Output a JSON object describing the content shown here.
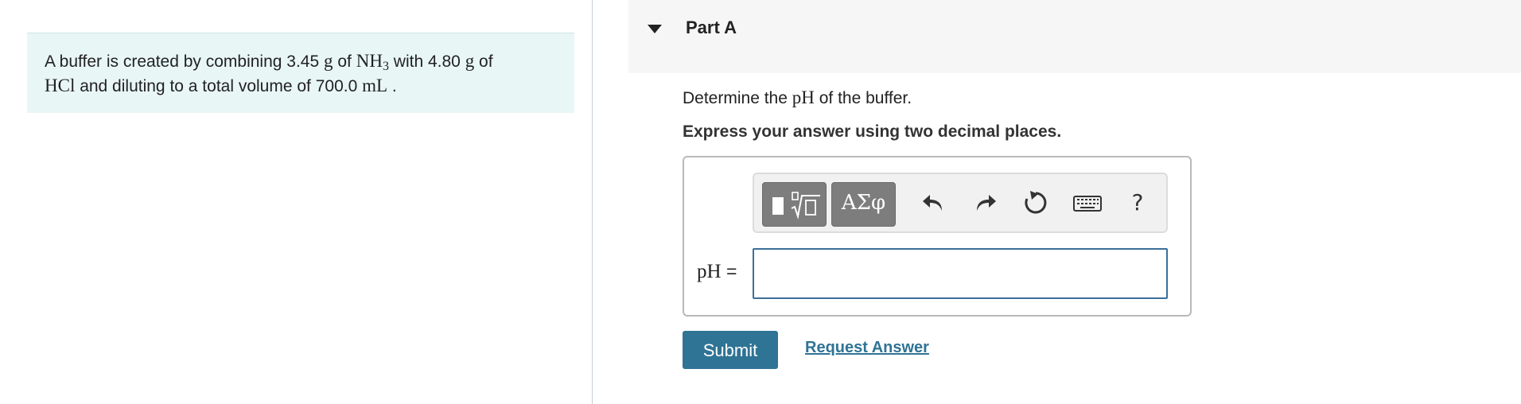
{
  "problem": {
    "text_1": "A buffer is created by combining 3.45",
    "unit_g_1": "g",
    "text_2": "of",
    "nh3_base": "NH",
    "nh3_sub": "3",
    "text_3": "with 4.80",
    "unit_g_2": "g",
    "text_4": "of",
    "hcl": "HCl",
    "text_5": "and diluting to a total volume of 700.0",
    "unit_ml": "mL",
    "text_6": "."
  },
  "part": {
    "title": "Part A",
    "question_prefix": "Determine the",
    "question_ph": "pH",
    "question_suffix": "of the buffer.",
    "instruction": "Express your answer using two decimal places."
  },
  "toolbar": {
    "symbols_label": "ΑΣφ",
    "help_label": "?",
    "icons": [
      "templates-icon",
      "symbols-icon",
      "undo-icon",
      "redo-icon",
      "reset-icon",
      "keyboard-icon",
      "help-icon"
    ]
  },
  "answer": {
    "label_var": "pH",
    "label_eq": " =",
    "value": ""
  },
  "actions": {
    "submit_label": "Submit",
    "request_label": "Request Answer"
  },
  "colors": {
    "problem_bg": "#e9f6f6",
    "primary_button": "#2f7395",
    "input_border": "#3b6f9a",
    "toolbar_button": "#7d7d7d"
  }
}
